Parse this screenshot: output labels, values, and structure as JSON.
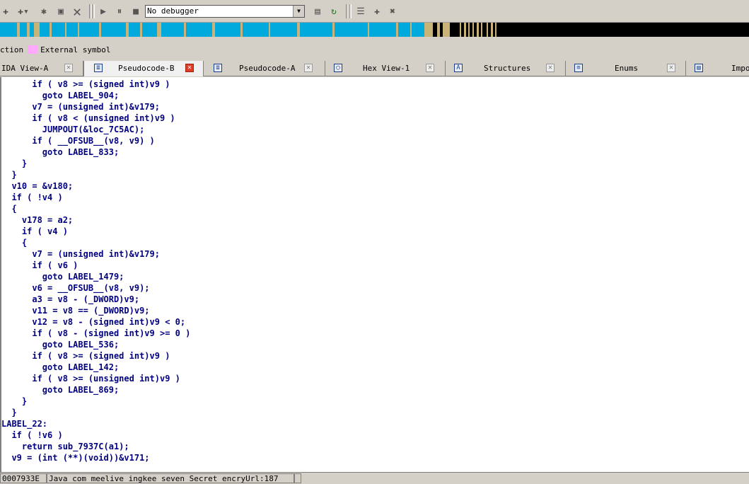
{
  "toolbar": {
    "debugger_select": "No debugger",
    "icons": [
      "add-icon",
      "add-dropdown-icon",
      "gear-icon",
      "image-icon",
      "close-icon",
      "play-icon",
      "pause-icon",
      "stop-icon",
      "binary-icon",
      "refresh-icon",
      "list-icon",
      "add-breakpoint-icon",
      "clear-breakpoint-icon"
    ]
  },
  "legend": {
    "prefix": "ction",
    "label": "External symbol",
    "swatch_color": "#ffaaff"
  },
  "navbar_colors": {
    "code": "#00aadd",
    "data": "#c8b478",
    "other": "#000000"
  },
  "tabs": [
    {
      "label": "IDA View-A",
      "icon": "graph-icon",
      "active": false
    },
    {
      "label": "Pseudocode-B",
      "icon": "pseudocode-icon",
      "active": true
    },
    {
      "label": "Pseudocode-A",
      "icon": "pseudocode-icon",
      "active": false
    },
    {
      "label": "Hex View-1",
      "icon": "hex-icon",
      "active": false
    },
    {
      "label": "Structures",
      "icon": "structures-icon",
      "active": false
    },
    {
      "label": "Enums",
      "icon": "enums-icon",
      "active": false
    },
    {
      "label": "Impo",
      "icon": "imports-icon",
      "active": false
    }
  ],
  "code_lines": [
    "      if ( v8 >= (signed int)v9 )",
    "        goto LABEL_904;",
    "      v7 = (unsigned int)&v179;",
    "      if ( v8 < (unsigned int)v9 )",
    "        JUMPOUT(&loc_7C5AC);",
    "      if ( __OFSUB__(v8, v9) )",
    "        goto LABEL_833;",
    "    }",
    "  }",
    "  v10 = &v180;",
    "  if ( !v4 )",
    "  {",
    "    v178 = a2;",
    "    if ( v4 )",
    "    {",
    "      v7 = (unsigned int)&v179;",
    "      if ( v6 )",
    "        goto LABEL_1479;",
    "      v6 = __OFSUB__(v8, v9);",
    "      a3 = v8 - (_DWORD)v9;",
    "      v11 = v8 == (_DWORD)v9;",
    "      v12 = v8 - (signed int)v9 < 0;",
    "      if ( v8 - (signed int)v9 >= 0 )",
    "        goto LABEL_536;",
    "      if ( v8 >= (signed int)v9 )",
    "        goto LABEL_142;",
    "      if ( v8 >= (unsigned int)v9 )",
    "        goto LABEL_869;",
    "    }",
    "  }",
    "LABEL_22:",
    "  if ( !v6 )",
    "    return sub_7937C(a1);",
    "  v9 = (int (**)(void))&v171;"
  ],
  "status": {
    "address": "0007933E",
    "location": "Java_com_meelive_ingkee_seven_Secret_encryUrl:187"
  }
}
